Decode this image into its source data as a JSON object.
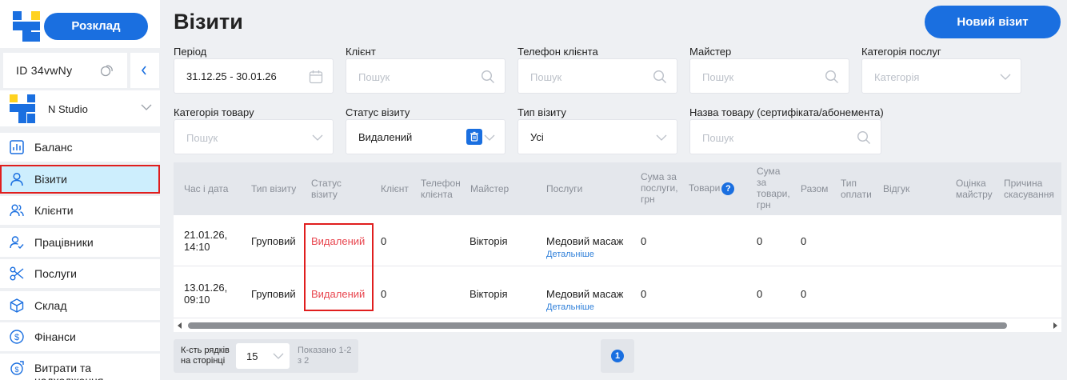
{
  "sidebar": {
    "schedule_label": "Розклад",
    "account_id": "ID 34vwNy",
    "studio_name": "N Studio",
    "nav": [
      {
        "label": "Баланс",
        "icon": "chart-icon"
      },
      {
        "label": "Візити",
        "icon": "user-icon"
      },
      {
        "label": "Клієнти",
        "icon": "users-icon"
      },
      {
        "label": "Працівники",
        "icon": "user-check-icon"
      },
      {
        "label": "Послуги",
        "icon": "scissors-icon"
      },
      {
        "label": "Склад",
        "icon": "box-icon"
      },
      {
        "label": "Фінанси",
        "icon": "dollar-icon"
      },
      {
        "label": "Витрати та надходження",
        "icon": "exchange-icon"
      }
    ]
  },
  "page": {
    "title": "Візити",
    "new_visit_label": "Новий візит"
  },
  "filters": {
    "period": {
      "label": "Період",
      "value": "31.12.25 - 30.01.26"
    },
    "client": {
      "label": "Клієнт",
      "placeholder": "Пошук"
    },
    "client_phone": {
      "label": "Телефон клієнта",
      "placeholder": "Пошук"
    },
    "master": {
      "label": "Майстер",
      "placeholder": "Пошук"
    },
    "service_category": {
      "label": "Категорія послуг",
      "placeholder": "Категорія"
    },
    "product_category": {
      "label": "Категорія товару",
      "placeholder": "Пошук"
    },
    "visit_status": {
      "label": "Статус візиту",
      "value": "Видалений"
    },
    "visit_type": {
      "label": "Тип візиту",
      "value": "Усі"
    },
    "product_name": {
      "label": "Назва товару (сертифіката/абонемента)",
      "placeholder": "Пошук"
    }
  },
  "table": {
    "headers": {
      "datetime": "Час і дата",
      "visit_type": "Тип візиту",
      "status": "Статус візиту",
      "client": "Клієнт",
      "phone": "Телефон клієнта",
      "master": "Майстер",
      "services": "Послуги",
      "services_sum": "Сума за послуги, грн",
      "goods": "Товари",
      "goods_sum": "Сума за товари, грн",
      "total": "Разом",
      "payment_type": "Тип оплати",
      "review": "Відгук",
      "master_rating": "Оцінка майстру",
      "cancel_reason": "Причина скасування"
    },
    "help_symbol": "?",
    "rows": [
      {
        "datetime": "21.01.26, 14:10",
        "visit_type": "Груповий",
        "status": "Видалений",
        "client": "0",
        "master": "Вікторія",
        "service": "Медовий масаж",
        "details": "Детальніше",
        "services_sum": "0",
        "goods_sum": "0",
        "total": "0"
      },
      {
        "datetime": "13.01.26, 09:10",
        "visit_type": "Груповий",
        "status": "Видалений",
        "client": "0",
        "master": "Вікторія",
        "service": "Медовий масаж",
        "details": "Детальніше",
        "services_sum": "0",
        "goods_sum": "0",
        "total": "0"
      }
    ]
  },
  "footer": {
    "rows_per_page_label": "К-сть рядків на сторінці",
    "rows_per_page_value": "15",
    "shown_label": "Показано 1-2 з 2",
    "current_page": "1"
  },
  "colors": {
    "accent": "#1a6fe0",
    "deleted_status": "#e8454e",
    "active_nav_bg": "#cdeefd",
    "highlight_outline": "#e01e1e"
  }
}
